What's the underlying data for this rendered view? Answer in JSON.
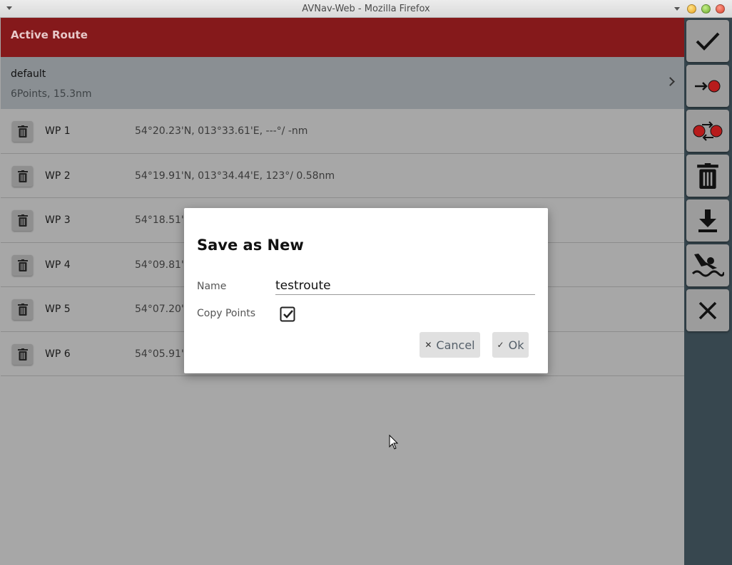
{
  "window": {
    "title": "AVNav-Web - Mozilla Firefox"
  },
  "header": {
    "title": "Active Route"
  },
  "route": {
    "name": "default",
    "meta": "6Points, 15.3nm"
  },
  "waypoints": [
    {
      "name": "WP 1",
      "info": "54°20.23'N, 013°33.61'E, ---°/ -nm"
    },
    {
      "name": "WP 2",
      "info": "54°19.91'N, 013°34.44'E, 123°/ 0.58nm"
    },
    {
      "name": "WP 3",
      "info": "54°18.51'"
    },
    {
      "name": "WP 4",
      "info": "54°09.81'"
    },
    {
      "name": "WP 5",
      "info": "54°07.20'"
    },
    {
      "name": "WP 6",
      "info": "54°05.91'"
    }
  ],
  "toolbar": {
    "buttons": [
      "check-icon",
      "route-to-icon",
      "invert-route-icon",
      "trash-icon",
      "download-icon",
      "swimmer-icon",
      "close-icon"
    ]
  },
  "dialog": {
    "title": "Save as New",
    "name_label": "Name",
    "name_value": "testroute",
    "copy_label": "Copy Points",
    "copy_checked": true,
    "cancel_label": "Cancel",
    "ok_label": "Ok"
  },
  "colors": {
    "header_bg": "#85191b",
    "route_info_bg": "#8a8f93",
    "toolbar_bg": "#37474f",
    "route_dot": "#b71c1c"
  }
}
